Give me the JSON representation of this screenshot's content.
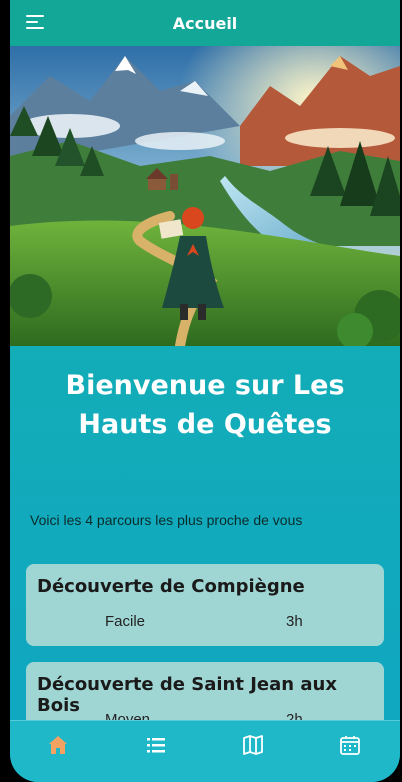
{
  "header": {
    "title": "Accueil"
  },
  "welcome": {
    "title": "Bienvenue sur Les Hauts de Quêtes",
    "subtitle": "Voici les 4 parcours les plus proche de vous"
  },
  "routes": [
    {
      "name": "Découverte de Compiègne",
      "difficulty": "Facile",
      "duration": "3h"
    },
    {
      "name": "Découverte de Saint Jean aux Bois",
      "difficulty": "Moyen",
      "duration": "2h"
    }
  ],
  "nav": {
    "items": [
      {
        "icon": "home-icon",
        "active": true
      },
      {
        "icon": "list-icon",
        "active": false
      },
      {
        "icon": "map-icon",
        "active": false
      },
      {
        "icon": "calendar-icon",
        "active": false
      }
    ]
  },
  "colors": {
    "header": "#12a796",
    "background": "#12acb9",
    "card": "#9fd6d4",
    "nav_active": "#f4a261",
    "nav_inactive": "#ffffff"
  }
}
